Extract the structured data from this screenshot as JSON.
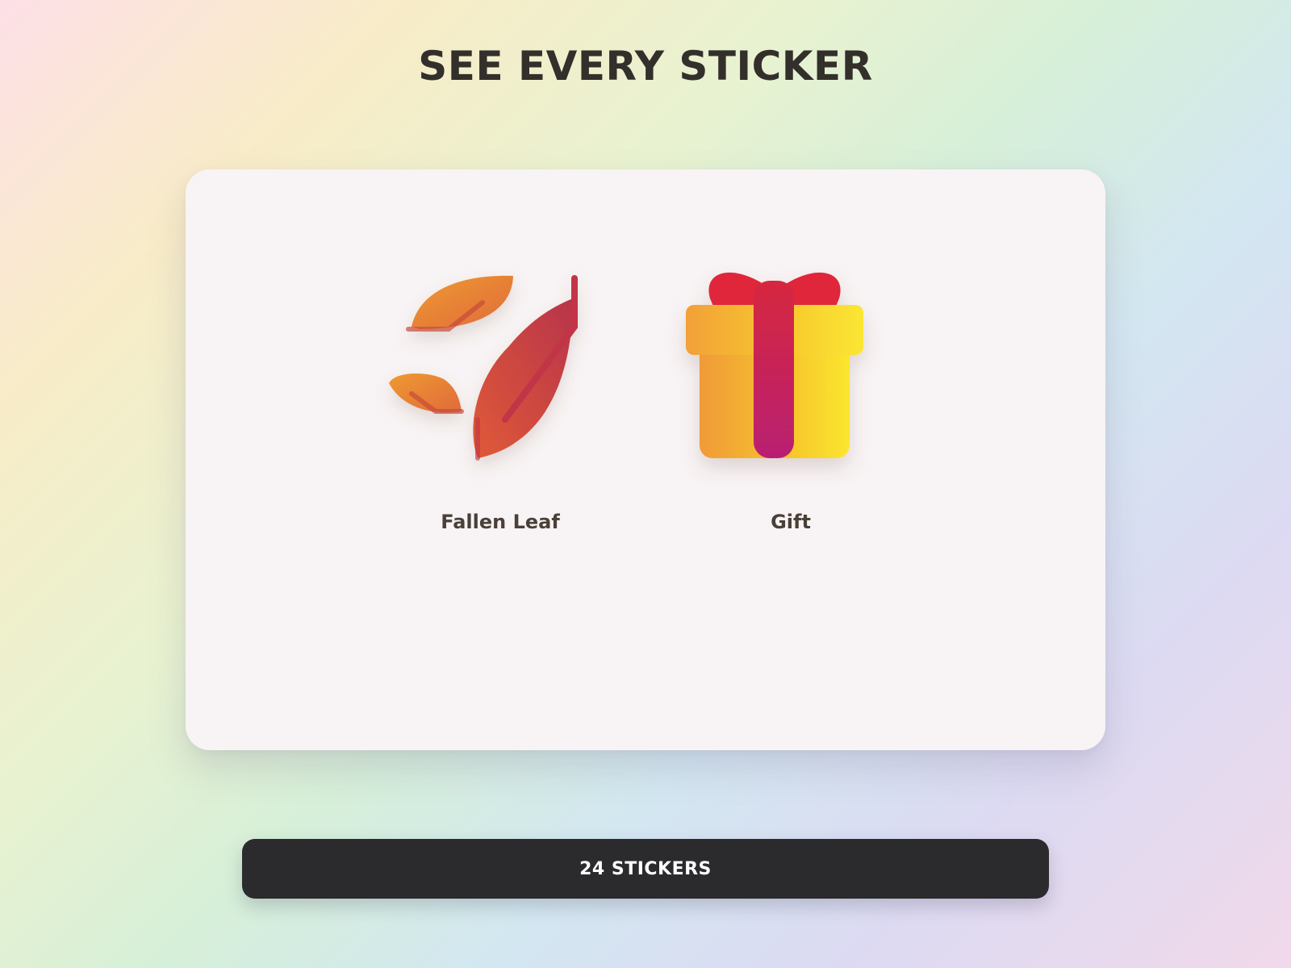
{
  "header": {
    "title": "SEE EVERY STICKER"
  },
  "stickers": [
    {
      "label": "Fallen Leaf",
      "icon": "fallen-leaf-icon"
    },
    {
      "label": "Gift",
      "icon": "gift-icon"
    }
  ],
  "footer": {
    "count_label": "24 STICKERS"
  },
  "colors": {
    "title_text": "#332f2b",
    "panel_background": "#f8f4f5",
    "label_text": "#4a4038",
    "button_background": "#2b2b2d",
    "button_text": "#ffffff",
    "leaf_orange": "#e98a2e",
    "leaf_red": "#c8413f",
    "gift_box_yellow": "#f8cc2a",
    "gift_ribbon": "#c2245e",
    "gift_bow": "#e0283a"
  }
}
